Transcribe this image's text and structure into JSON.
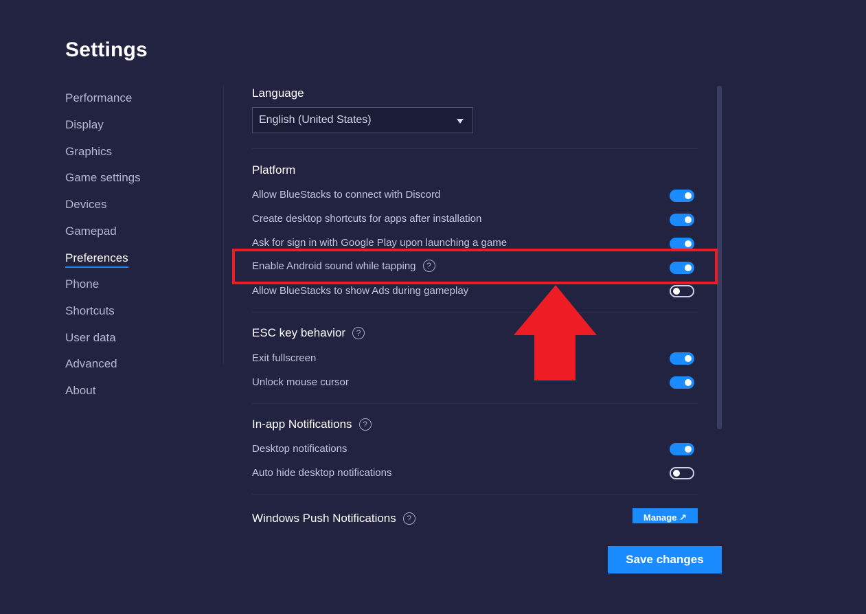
{
  "page": {
    "title": "Settings"
  },
  "sidebar": {
    "items": [
      {
        "label": "Performance"
      },
      {
        "label": "Display"
      },
      {
        "label": "Graphics"
      },
      {
        "label": "Game settings"
      },
      {
        "label": "Devices"
      },
      {
        "label": "Gamepad"
      },
      {
        "label": "Preferences",
        "active": true
      },
      {
        "label": "Phone"
      },
      {
        "label": "Shortcuts"
      },
      {
        "label": "User data"
      },
      {
        "label": "Advanced"
      },
      {
        "label": "About"
      }
    ]
  },
  "language": {
    "title": "Language",
    "selected": "English (United States)"
  },
  "platform": {
    "title": "Platform",
    "options": [
      {
        "label": "Allow BlueStacks to connect with Discord",
        "enabled": true
      },
      {
        "label": "Create desktop shortcuts for apps after installation",
        "enabled": true
      },
      {
        "label": "Ask for sign in with Google Play upon launching a game",
        "enabled": true
      },
      {
        "label": "Enable Android sound while tapping",
        "enabled": true,
        "help": true
      },
      {
        "label": "Allow BlueStacks to show Ads during gameplay",
        "enabled": false
      }
    ]
  },
  "esc": {
    "title": "ESC key behavior",
    "options": [
      {
        "label": "Exit fullscreen",
        "enabled": true
      },
      {
        "label": "Unlock mouse cursor",
        "enabled": true
      }
    ]
  },
  "notifications": {
    "title": "In-app Notifications",
    "options": [
      {
        "label": "Desktop notifications",
        "enabled": true
      },
      {
        "label": "Auto hide desktop notifications",
        "enabled": false
      }
    ]
  },
  "push": {
    "title": "Windows Push Notifications",
    "manage_label": "Manage ↗"
  },
  "footer": {
    "save_label": "Save changes"
  },
  "annotation": {
    "color": "#ee1c25"
  },
  "colors": {
    "accent": "#1a8cff",
    "background": "#212340"
  },
  "help_glyph": "?"
}
